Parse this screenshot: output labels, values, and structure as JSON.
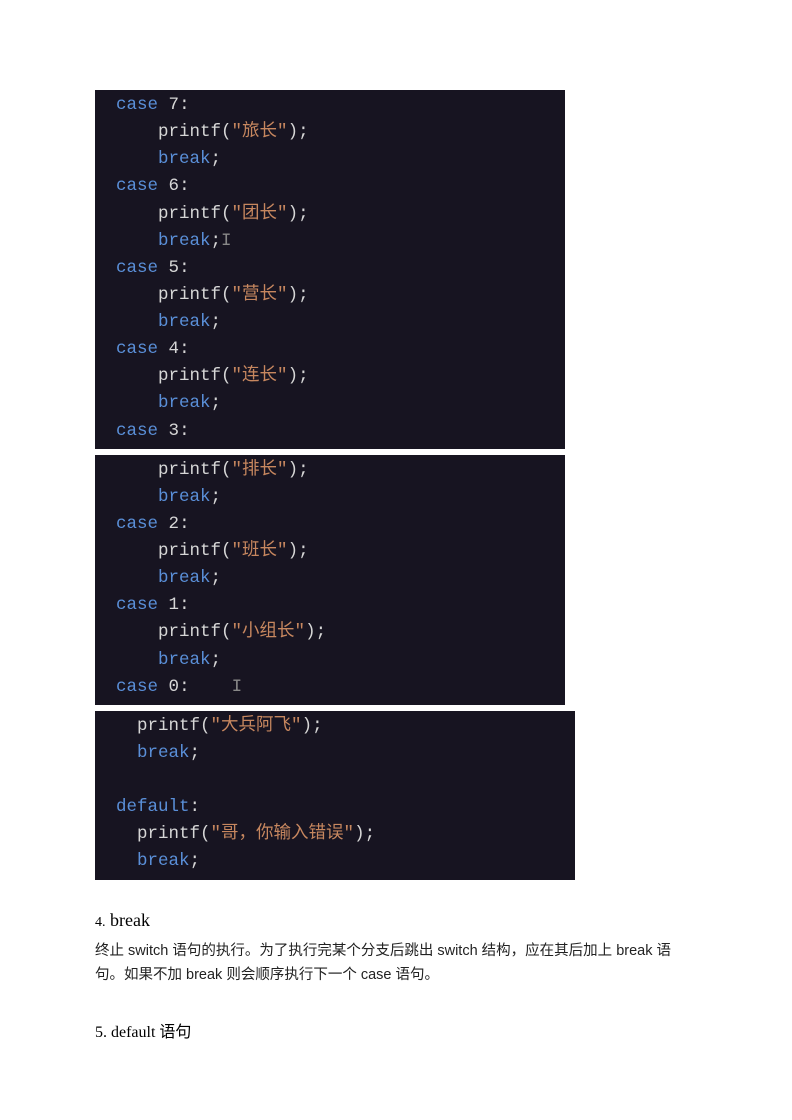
{
  "code1": {
    "l1_case": "case",
    "l1_num": "7",
    "l1_colon": ":",
    "l2_fn": "printf",
    "l2_open": "(",
    "l2_str": "\"旅长\"",
    "l2_close": ")",
    "l2_semi": ";",
    "l3_break": "break",
    "l3_semi": ";",
    "l4_case": "case",
    "l4_num": "6",
    "l4_colon": ":",
    "l5_fn": "printf",
    "l5_open": "(",
    "l5_str": "\"团长\"",
    "l5_close": ")",
    "l5_semi": ";",
    "l6_break": "break",
    "l6_semi": ";",
    "l6_caret": "I",
    "l7_case": "case",
    "l7_num": "5",
    "l7_colon": ":",
    "l8_fn": "printf",
    "l8_open": "(",
    "l8_str": "\"营长\"",
    "l8_close": ")",
    "l8_semi": ";",
    "l9_break": "break",
    "l9_semi": ";",
    "l10_case": "case",
    "l10_num": "4",
    "l10_colon": ":",
    "l11_fn": "printf",
    "l11_open": "(",
    "l11_str": "\"连长\"",
    "l11_close": ")",
    "l11_semi": ";",
    "l12_break": "break",
    "l12_semi": ";",
    "l13_case": "case",
    "l13_num": "3",
    "l13_colon": ":"
  },
  "code2": {
    "l1_fn": "printf",
    "l1_open": "(",
    "l1_str": "\"排长\"",
    "l1_close": ")",
    "l1_semi": ";",
    "l2_break": "break",
    "l2_semi": ";",
    "l3_case": "case",
    "l3_num": "2",
    "l3_colon": ":",
    "l4_fn": "printf",
    "l4_open": "(",
    "l4_str": "\"班长\"",
    "l4_close": ")",
    "l4_semi": ";",
    "l5_break": "break",
    "l5_semi": ";",
    "l6_case": "case",
    "l6_num": "1",
    "l6_colon": ":",
    "l7_fn": "printf",
    "l7_open": "(",
    "l7_str": "\"小组长\"",
    "l7_close": ")",
    "l7_semi": ";",
    "l8_break": "break",
    "l8_semi": ";",
    "l9_case": "case",
    "l9_num": "0",
    "l9_colon": ":",
    "l9_caret": "I"
  },
  "code3": {
    "l1_fn": "printf",
    "l1_open": "(",
    "l1_str": "\"大兵阿飞\"",
    "l1_close": ")",
    "l1_semi": ";",
    "l2_break": "break",
    "l2_semi": ";",
    "l4_default": "default",
    "l4_colon": ":",
    "l5_fn": "printf",
    "l5_open": "(",
    "l5_str": "\"哥，你输入错误\"",
    "l5_close": ")",
    "l5_semi": ";",
    "l6_break": "break",
    "l6_semi": ";"
  },
  "section4": {
    "num": "4.",
    "title": "break",
    "para": "终止 switch 语句的执行。为了执行完某个分支后跳出 switch 结构，应在其后加上 break 语句。如果不加 break 则会顺序执行下一个 case 语句。"
  },
  "section5": {
    "num": "5.",
    "title": "default 语句"
  }
}
